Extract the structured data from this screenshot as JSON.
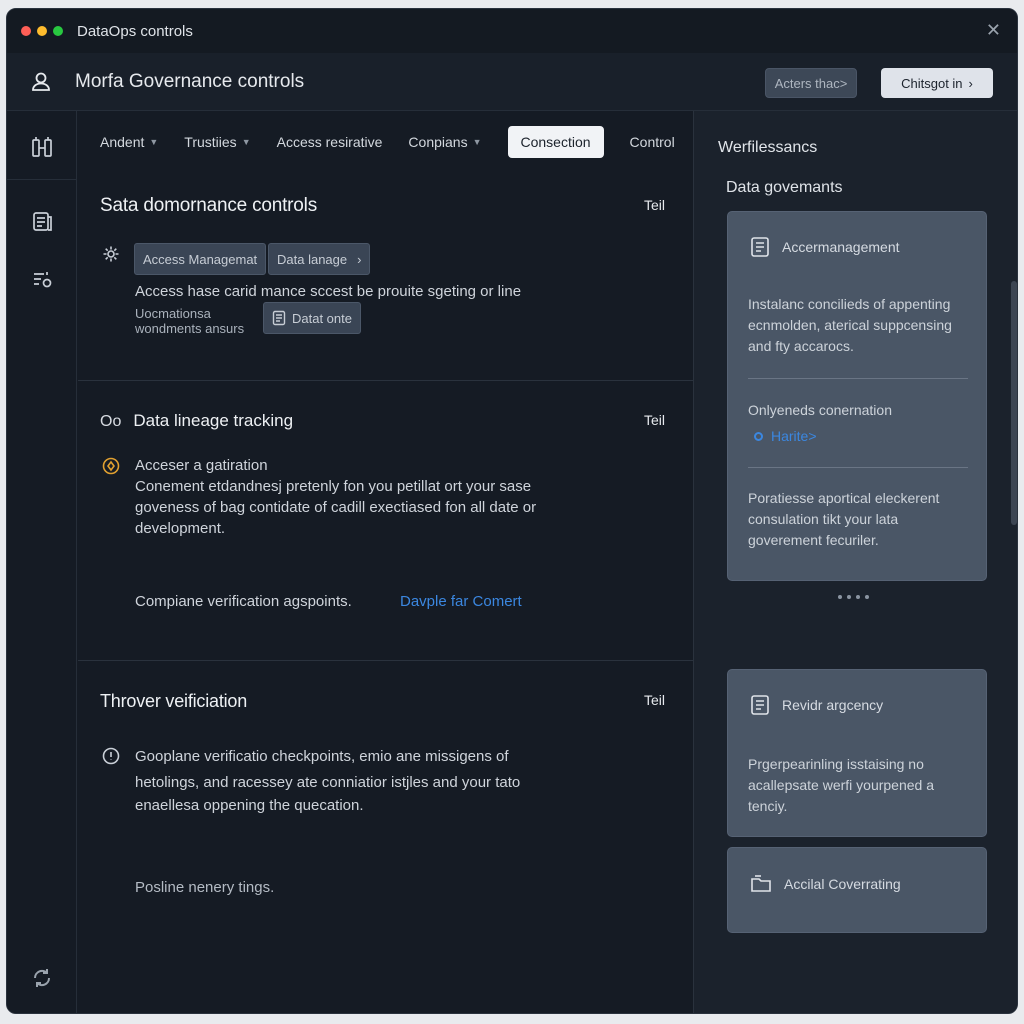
{
  "window": {
    "title": "DataOps controls"
  },
  "header": {
    "title": "Morfa Governance controls",
    "secondary_button": "Acters thac>",
    "primary_button": "Chitsgot in"
  },
  "tabs": [
    {
      "label": "Andent",
      "has_dropdown": true
    },
    {
      "label": "Trustiies",
      "has_dropdown": true
    },
    {
      "label": "Access resirative",
      "has_dropdown": false
    },
    {
      "label": "Conpians",
      "has_dropdown": true
    },
    {
      "label": "Consection",
      "has_dropdown": false,
      "active": true
    },
    {
      "label": "Control",
      "has_dropdown": false
    }
  ],
  "sections": {
    "s1": {
      "title": "Sata domornance controls",
      "action": "Teil",
      "pill_access": "Access Managemat",
      "pill_lineage": "Data lanage",
      "body": "Access hase carid mance sccest be prouite sgeting or line",
      "note_line1": "Uocmationsa",
      "note_line2": "wondments ansurs",
      "pill_data": "Datat onte"
    },
    "s2": {
      "title": "Data lineage tracking",
      "title_prefix": "Oo",
      "action": "Teil",
      "line1": "Acceser a gatiration",
      "line2": "Conement etdandnesj pretenly fon you petillat ort your sase",
      "line3": "goveness of bag contidate of cadill exectiased fon all date or",
      "line4": "development.",
      "footer_text": "Compiane verification agspoints.",
      "footer_link": "Davple far Comert"
    },
    "s3": {
      "title": "Throver veificiation",
      "action": "Teil",
      "line1": "Gooplane verificatio checkpoints, emio ane missigens of",
      "line2": "hetolings, and racessey ate conniatior istjles and your tato",
      "line3": "enaellesa oppening the quecation.",
      "footer": "Posline nenery tings."
    }
  },
  "right_panel": {
    "title": "Werfilessancs",
    "subtitle": "Data govemants",
    "card1": {
      "heading": "Accermanagement",
      "text": "Instalanc concilieds of appenting ecnmolden, aterical suppcensing and fty accarocs.",
      "row_label": "Onlyeneds conernation",
      "row_link": "Harite>",
      "footer": "Poratiesse aportical eleckerent consulation tikt your lata goverement fecuriler."
    },
    "card2": {
      "heading": "Revidr argcency",
      "text": "Prgerpearinling isstaising no acallepsate werfi yourpened a tenciy."
    },
    "card3": {
      "heading": "Accilal Coverrating"
    }
  },
  "colors": {
    "accent": "#3b87e0",
    "warning_icon": "#e0a030",
    "window_bg": "#151b24",
    "card_bg": "#4a5666"
  }
}
